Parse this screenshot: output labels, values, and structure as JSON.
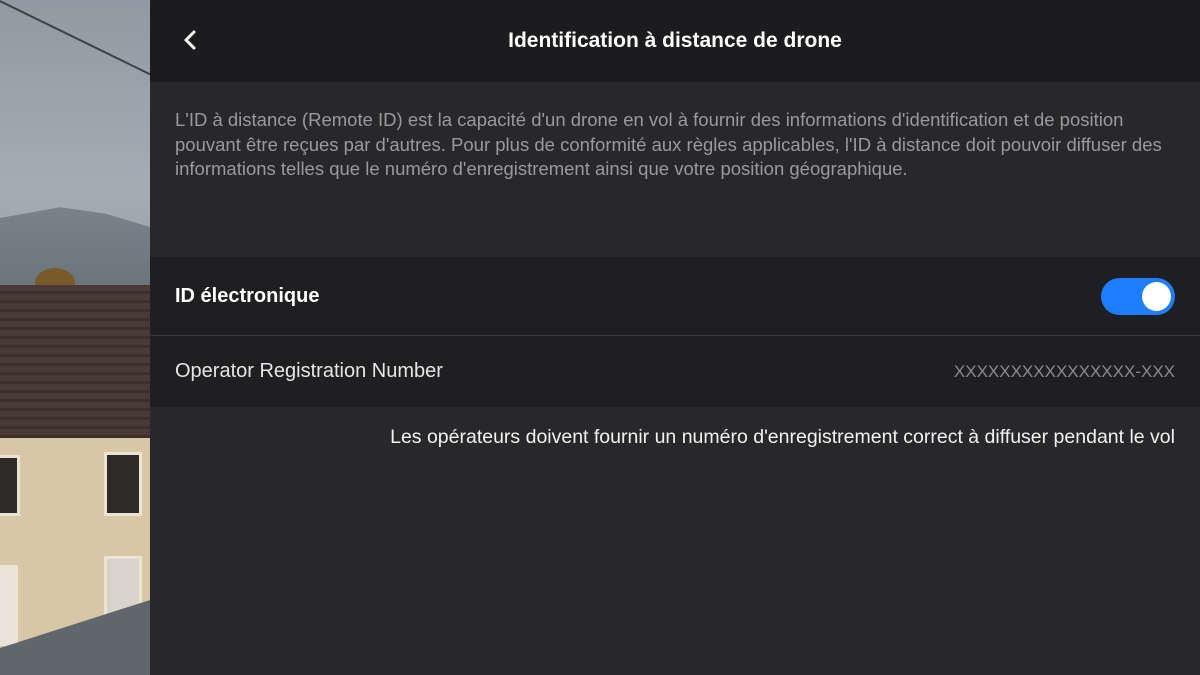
{
  "header": {
    "title": "Identification à distance de drone",
    "back_icon": "chevron-left-icon"
  },
  "description": "L'ID à distance (Remote ID) est la capacité d'un drone en vol à fournir des informations d'identification et de position pouvant être reçues par d'autres. Pour plus de conformité aux règles applicables, l'ID à distance doit pouvoir diffuser des informations telles que le numéro d'enregistrement ainsi que votre position géographique.",
  "settings": {
    "electronic_id": {
      "label": "ID électronique",
      "enabled": true
    },
    "operator_registration": {
      "label": "Operator Registration Number",
      "value": "XXXXXXXXXXXXXXXX-XXX"
    }
  },
  "note": "Les opérateurs doivent fournir un numéro d'enregistrement correct à diffuser pendant le vol",
  "colors": {
    "accent": "#1d7dff",
    "header_bg": "#1c1c1e",
    "panel_bg": "#28282a"
  }
}
